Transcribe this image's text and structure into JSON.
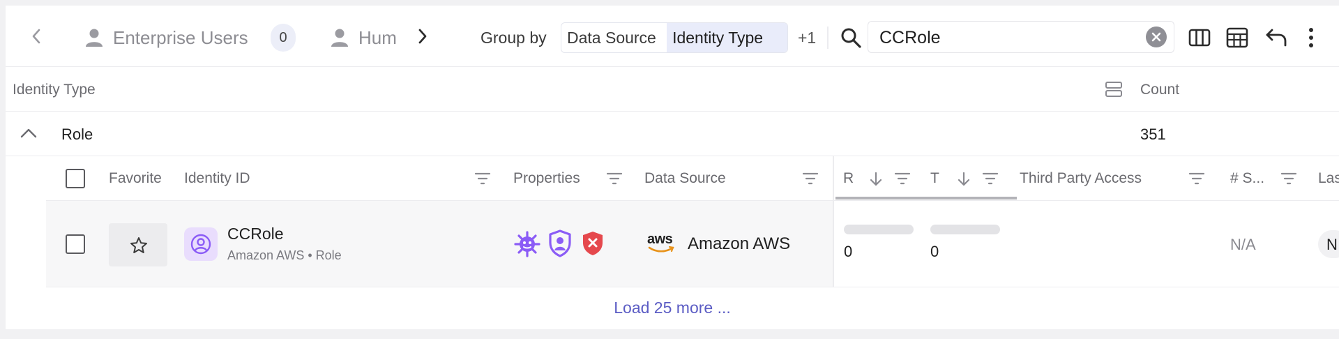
{
  "toolbar": {
    "tabs": [
      {
        "label": "Enterprise Users",
        "count": "0"
      },
      {
        "label": "Hum"
      }
    ],
    "group_by_label": "Group by",
    "group_by_options": [
      "Data Source",
      "Identity Type"
    ],
    "group_by_selected": "Identity Type",
    "extra_count": "+1",
    "search_value": "CCRole"
  },
  "group_header": {
    "label": "Identity Type",
    "count_label": "Count"
  },
  "group": {
    "name": "Role",
    "count": "351"
  },
  "columns": {
    "favorite": "Favorite",
    "identity_id": "Identity ID",
    "properties": "Properties",
    "data_source": "Data Source",
    "col_r": "R",
    "col_t": "T",
    "third_party": "Third Party Access",
    "num_s": "# S...",
    "last": "Las"
  },
  "row": {
    "identity_name": "CCRole",
    "identity_sub": "Amazon AWS • Role",
    "data_source_logo": "aws",
    "data_source": "Amazon AWS",
    "r_value": "0",
    "t_value": "0",
    "num_s_value": "N/A",
    "last_value": "N"
  },
  "load_more": "Load 25 more ...",
  "colors": {
    "accent": "#5b5cc4",
    "purple_icon": "#8b5cf6",
    "red_icon": "#e5484d"
  }
}
